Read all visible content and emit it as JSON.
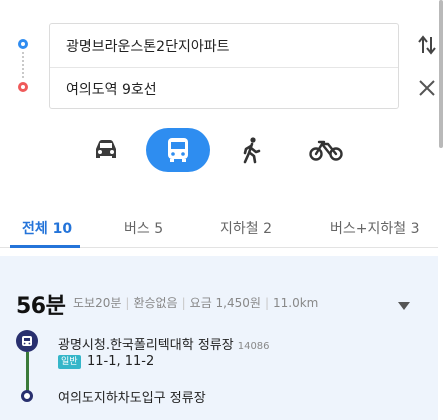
{
  "route": {
    "origin": "광명브라운스톤2단지아파트",
    "destination": "여의도역 9호선",
    "origin_color": "#2f8cf0",
    "destination_color": "#ef5a5a"
  },
  "icons": {
    "swap": "swap-vertical-icon",
    "clear": "close-icon",
    "car": "car-icon",
    "transit": "bus-icon",
    "walk": "walk-icon",
    "bike": "bicycle-icon",
    "expand": "caret-down-icon"
  },
  "modes": {
    "selected": "transit",
    "accent": "#2e8df0"
  },
  "tabs": [
    {
      "label": "전체 10",
      "active": true
    },
    {
      "label": "버스 5",
      "active": false
    },
    {
      "label": "지하철 2",
      "active": false
    },
    {
      "label": "버스+지하철 3",
      "active": false
    }
  ],
  "result": {
    "duration": "56분",
    "walk": "도보20분",
    "transfer": "환승없음",
    "fare": "요금 1,450원",
    "distance": "11.0km",
    "start_stop": "광명시청.한국폴리텍대학 정류장",
    "start_stop_id": "14086",
    "bus_type": "일반",
    "bus_numbers": "11-1, 11-2",
    "end_stop": "여의도지하차도입구 정류장",
    "bus_type_color": "#35b6c9",
    "line_color": "#3a7a3a"
  }
}
